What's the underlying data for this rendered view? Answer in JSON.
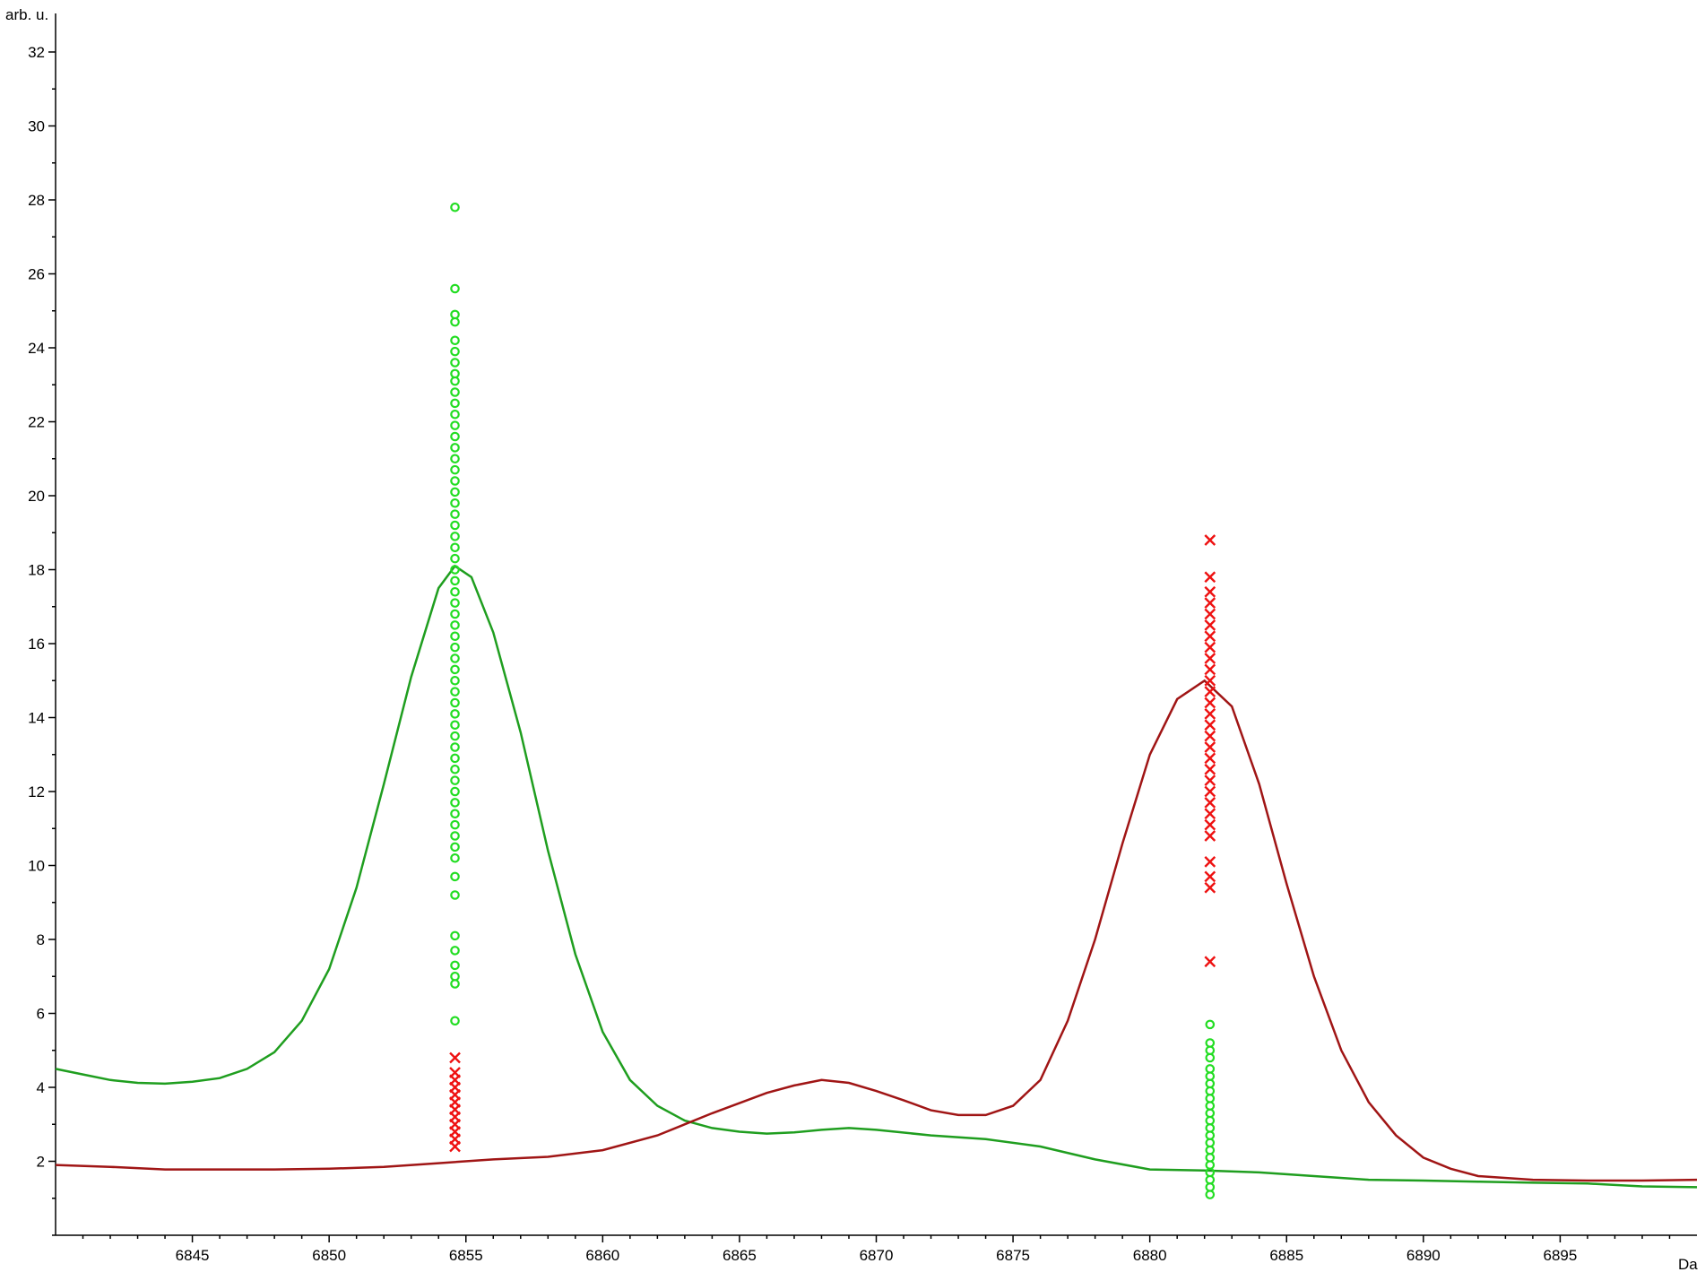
{
  "chart_data": {
    "type": "line",
    "title": "",
    "xlabel": "",
    "ylabel": "",
    "x_unit": "Da",
    "y_unit": "arb. u.",
    "xlim": [
      6840,
      6900
    ],
    "ylim": [
      0,
      32.8
    ],
    "x_ticks": [
      6845,
      6850,
      6855,
      6860,
      6865,
      6870,
      6875,
      6880,
      6885,
      6890,
      6895
    ],
    "y_ticks": [
      2,
      4,
      6,
      8,
      10,
      12,
      14,
      16,
      18,
      20,
      22,
      24,
      26,
      28,
      30,
      32
    ],
    "grid": false,
    "legend": "none",
    "colors": {
      "green_line": "#1f9e1f",
      "red_line": "#a01515",
      "green_markers": "#22dd22",
      "red_markers": "#ee1111"
    },
    "lines": [
      {
        "color_key": "green_line",
        "points": [
          [
            6840,
            4.5
          ],
          [
            6841,
            4.35
          ],
          [
            6842,
            4.2
          ],
          [
            6843,
            4.12
          ],
          [
            6844,
            4.1
          ],
          [
            6845,
            4.15
          ],
          [
            6846,
            4.25
          ],
          [
            6847,
            4.5
          ],
          [
            6848,
            4.95
          ],
          [
            6849,
            5.8
          ],
          [
            6850,
            7.2
          ],
          [
            6851,
            9.4
          ],
          [
            6852,
            12.2
          ],
          [
            6853,
            15.1
          ],
          [
            6854,
            17.5
          ],
          [
            6854.6,
            18.1
          ],
          [
            6855.2,
            17.8
          ],
          [
            6856,
            16.3
          ],
          [
            6857,
            13.6
          ],
          [
            6858,
            10.4
          ],
          [
            6859,
            7.6
          ],
          [
            6860,
            5.5
          ],
          [
            6861,
            4.2
          ],
          [
            6862,
            3.5
          ],
          [
            6863,
            3.1
          ],
          [
            6864,
            2.9
          ],
          [
            6865,
            2.8
          ],
          [
            6866,
            2.75
          ],
          [
            6867,
            2.78
          ],
          [
            6868,
            2.85
          ],
          [
            6869,
            2.9
          ],
          [
            6870,
            2.85
          ],
          [
            6872,
            2.7
          ],
          [
            6874,
            2.6
          ],
          [
            6876,
            2.4
          ],
          [
            6878,
            2.05
          ],
          [
            6880,
            1.78
          ],
          [
            6882,
            1.75
          ],
          [
            6884,
            1.7
          ],
          [
            6886,
            1.6
          ],
          [
            6888,
            1.5
          ],
          [
            6890,
            1.48
          ],
          [
            6892,
            1.45
          ],
          [
            6894,
            1.42
          ],
          [
            6896,
            1.4
          ],
          [
            6898,
            1.32
          ],
          [
            6900,
            1.3
          ]
        ]
      },
      {
        "color_key": "red_line",
        "points": [
          [
            6840,
            1.9
          ],
          [
            6842,
            1.85
          ],
          [
            6844,
            1.78
          ],
          [
            6846,
            1.78
          ],
          [
            6848,
            1.78
          ],
          [
            6850,
            1.8
          ],
          [
            6852,
            1.85
          ],
          [
            6854,
            1.95
          ],
          [
            6856,
            2.05
          ],
          [
            6858,
            2.12
          ],
          [
            6860,
            2.3
          ],
          [
            6862,
            2.7
          ],
          [
            6864,
            3.3
          ],
          [
            6866,
            3.85
          ],
          [
            6867,
            4.05
          ],
          [
            6868,
            4.2
          ],
          [
            6869,
            4.12
          ],
          [
            6870,
            3.9
          ],
          [
            6871,
            3.65
          ],
          [
            6872,
            3.38
          ],
          [
            6873,
            3.25
          ],
          [
            6874,
            3.25
          ],
          [
            6875,
            3.5
          ],
          [
            6876,
            4.2
          ],
          [
            6877,
            5.8
          ],
          [
            6878,
            8.0
          ],
          [
            6879,
            10.6
          ],
          [
            6880,
            13.0
          ],
          [
            6881,
            14.5
          ],
          [
            6882,
            15.0
          ],
          [
            6883,
            14.3
          ],
          [
            6884,
            12.2
          ],
          [
            6885,
            9.5
          ],
          [
            6886,
            7.0
          ],
          [
            6887,
            5.0
          ],
          [
            6888,
            3.6
          ],
          [
            6889,
            2.7
          ],
          [
            6890,
            2.1
          ],
          [
            6891,
            1.8
          ],
          [
            6892,
            1.6
          ],
          [
            6894,
            1.5
          ],
          [
            6896,
            1.48
          ],
          [
            6898,
            1.48
          ],
          [
            6900,
            1.5
          ]
        ]
      }
    ],
    "scatter": [
      {
        "color_key": "green_markers",
        "marker": "circle",
        "x": 6854.6,
        "y": [
          27.8,
          25.6,
          24.9,
          24.7,
          24.2,
          23.9,
          23.6,
          23.3,
          23.1,
          22.8,
          22.5,
          22.2,
          21.9,
          21.6,
          21.3,
          21.0,
          20.7,
          20.4,
          20.1,
          19.8,
          19.5,
          19.2,
          18.9,
          18.6,
          18.3,
          18.0,
          17.7,
          17.4,
          17.1,
          16.8,
          16.5,
          16.2,
          15.9,
          15.6,
          15.3,
          15.0,
          14.7,
          14.4,
          14.1,
          13.8,
          13.5,
          13.2,
          12.9,
          12.6,
          12.3,
          12.0,
          11.7,
          11.4,
          11.1,
          10.8,
          10.5,
          10.2,
          9.7,
          9.2,
          8.1,
          7.7,
          7.3,
          7.0,
          6.8,
          5.8
        ]
      },
      {
        "color_key": "red_markers",
        "marker": "cross",
        "x": 6854.6,
        "y": [
          4.8,
          4.4,
          4.2,
          4.0,
          3.8,
          3.6,
          3.4,
          3.2,
          3.0,
          2.8,
          2.6,
          2.4
        ]
      },
      {
        "color_key": "red_markers",
        "marker": "cross",
        "x": 6882.2,
        "y": [
          18.8,
          17.8,
          17.4,
          17.1,
          16.8,
          16.5,
          16.2,
          15.9,
          15.6,
          15.3,
          15.0,
          14.7,
          14.4,
          14.1,
          13.8,
          13.5,
          13.2,
          12.9,
          12.6,
          12.3,
          12.0,
          11.7,
          11.4,
          11.1,
          10.8,
          10.1,
          9.7,
          9.4,
          7.4
        ]
      },
      {
        "color_key": "green_markers",
        "marker": "circle",
        "x": 6882.2,
        "y": [
          5.7,
          5.2,
          5.0,
          4.8,
          4.5,
          4.3,
          4.1,
          3.9,
          3.7,
          3.5,
          3.3,
          3.1,
          2.9,
          2.7,
          2.5,
          2.3,
          2.1,
          1.9,
          1.7,
          1.5,
          1.3,
          1.1
        ]
      }
    ]
  }
}
